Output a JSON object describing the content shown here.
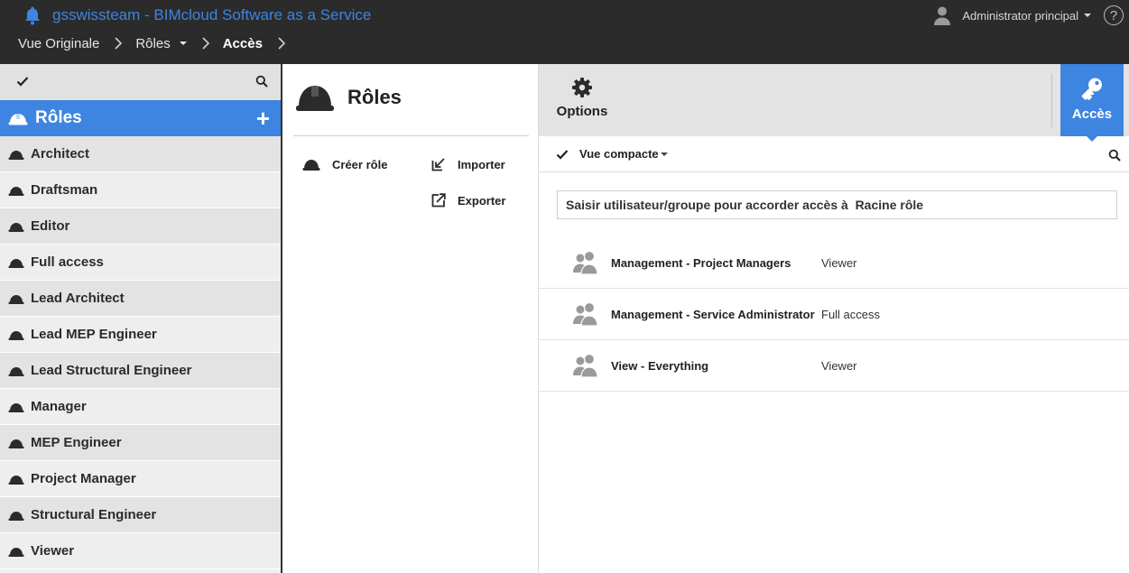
{
  "app": {
    "title": "gsswissteam - BIMcloud Software as a Service",
    "bell_icon": "bell-icon",
    "user_name": "Administrator principal",
    "help_glyph": "?"
  },
  "breadcrumb": {
    "items": [
      {
        "label": "Vue Originale"
      },
      {
        "label": "Rôles"
      },
      {
        "label": "Accès"
      }
    ]
  },
  "sidebar": {
    "header_label": "Rôles",
    "add_glyph": "+",
    "items": [
      {
        "label": "Architect"
      },
      {
        "label": "Draftsman"
      },
      {
        "label": "Editor"
      },
      {
        "label": "Full access"
      },
      {
        "label": "Lead Architect"
      },
      {
        "label": "Lead MEP Engineer"
      },
      {
        "label": "Lead Structural Engineer"
      },
      {
        "label": "Manager"
      },
      {
        "label": "MEP Engineer"
      },
      {
        "label": "Project Manager"
      },
      {
        "label": "Structural Engineer"
      },
      {
        "label": "Viewer"
      }
    ]
  },
  "middle": {
    "title": "Rôles",
    "create_label": "Créer rôle",
    "import_label": "Importer",
    "export_label": "Exporter"
  },
  "tabs": {
    "options_label": "Options",
    "access_label": "Accès"
  },
  "view": {
    "mode_label": "Vue compacte",
    "grant_placeholder": "Saisir utilisateur/groupe pour accorder accès à  Racine rôle"
  },
  "access": {
    "rows": [
      {
        "name": "Management - Project Managers",
        "role": "Viewer"
      },
      {
        "name": "Management - Service Administrator",
        "role": "Full access"
      },
      {
        "name": "View - Everything",
        "role": "Viewer"
      }
    ]
  },
  "colors": {
    "accent": "#3d85e0",
    "topbar": "#2b2b2b",
    "sidebar_bg": "#f0f0f0",
    "tabbar_bg": "#e3e3e3"
  }
}
